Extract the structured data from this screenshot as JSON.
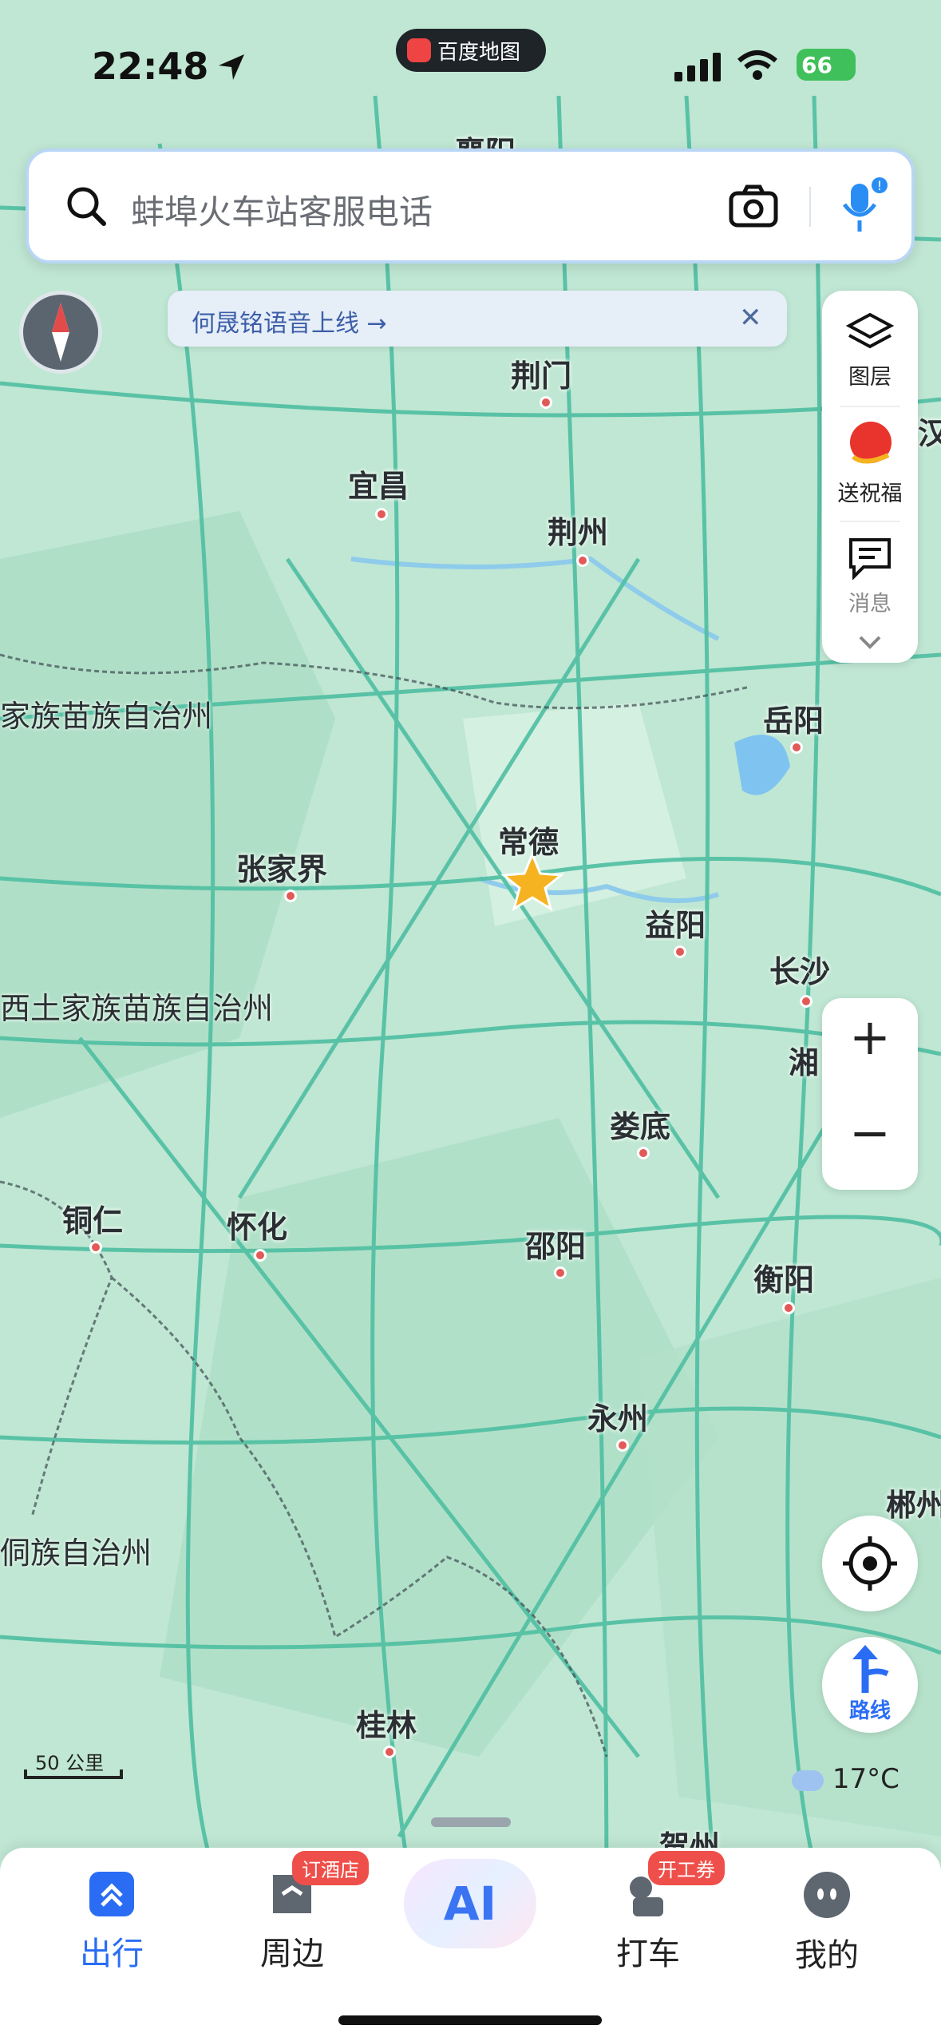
{
  "status_bar": {
    "time": "22:48",
    "app_pill": "百度地图",
    "battery": "66"
  },
  "search": {
    "placeholder": "蚌埠火车站客服电话"
  },
  "notice": {
    "text": "何晟铭语音上线 →",
    "close": "✕"
  },
  "right_panel": {
    "layers": "图层",
    "blessing": "送祝福",
    "messages": "消息"
  },
  "zoom": {
    "plus": "+",
    "minus": "−"
  },
  "route": {
    "label": "路线"
  },
  "scale": {
    "label": "50 公里"
  },
  "weather": {
    "temp": "17°C"
  },
  "map": {
    "cities": {
      "xiangyang": "襄阳",
      "jingmen": "荆门",
      "yichang": "宜昌",
      "jingzhou": "荆州",
      "yueyang": "岳阳",
      "changde": "常德",
      "zhangjiajie": "张家界",
      "yiyang": "益阳",
      "changsha": "长沙",
      "xiang": "湘",
      "loudi": "娄底",
      "tongren": "铜仁",
      "huaihua": "怀化",
      "shaoyang": "邵阳",
      "hengyang": "衡阳",
      "yongzhou": "永州",
      "chenzhou": "郴州",
      "guilin": "桂林",
      "hezhou": "贺州",
      "han": "汉"
    },
    "regions": {
      "enshi": "家族苗族自治州",
      "xiangxi": "西土家族苗族自治州",
      "qiandongnan": "侗族自治州"
    }
  },
  "nav": {
    "travel": "出行",
    "nearby": "周边",
    "nearby_badge": "订酒店",
    "ai": "AI",
    "taxi": "打车",
    "taxi_badge": "开工券",
    "me": "我的"
  }
}
